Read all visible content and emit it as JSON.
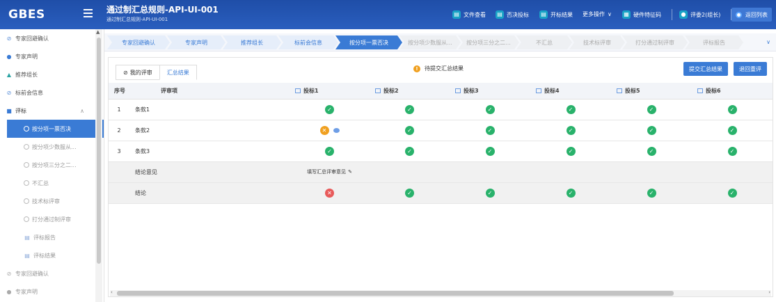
{
  "header": {
    "logo": "GBES",
    "project_title": "通过制汇总规则-API-UI-001",
    "project_subtitle": "通过制汇总规则-API-UI-001",
    "toolbar": [
      {
        "label": "文件查看",
        "icon": "file-icon",
        "color": "#19a3c6"
      },
      {
        "label": "否决投标",
        "icon": "reject-icon",
        "color": "#19a3c6"
      },
      {
        "label": "开标结果",
        "icon": "result-icon",
        "color": "#19a3c6"
      }
    ],
    "more_label": "更多操作",
    "hardware_label": "硬件特征码",
    "user_label": "评委2(组长)",
    "back_label": "返回列表"
  },
  "sidebar": {
    "items": [
      {
        "label": "专家回避确认",
        "icon": "check-circle-icon"
      },
      {
        "label": "专家声明",
        "icon": "user-icon"
      },
      {
        "label": "推荐组长",
        "icon": "users-icon"
      },
      {
        "label": "标前会信息",
        "icon": "check-circle-icon"
      },
      {
        "label": "评标",
        "icon": "folder-icon"
      }
    ],
    "sub_items": [
      {
        "label": "按分项一票否决",
        "active": true
      },
      {
        "label": "按分项少数服从..."
      },
      {
        "label": "按分项三分之二..."
      },
      {
        "label": "不汇总"
      },
      {
        "label": "技术标评审"
      },
      {
        "label": "打分通过制评审"
      }
    ],
    "bottom_items": [
      {
        "label": "评标报告",
        "icon": "doc-icon"
      },
      {
        "label": "评标结果",
        "icon": "doc-icon"
      },
      {
        "label": "专家回避确认",
        "icon": "check-circle-icon"
      },
      {
        "label": "专家声明",
        "icon": "user-icon"
      }
    ]
  },
  "steps": [
    "专家回避确认",
    "专家声明",
    "推荐组长",
    "标前会信息",
    "按分项一票否决",
    "按分项少数服从...",
    "按分项三分之二...",
    "不汇总",
    "技术标评审",
    "打分通过制评审",
    "评标报告"
  ],
  "active_step": 4,
  "tabs": {
    "my_review": "我的评审",
    "summary": "汇总结果"
  },
  "status_text": "待提交汇总结果",
  "buttons": {
    "submit": "提交汇总结果",
    "return": "退回重评"
  },
  "table": {
    "headers": [
      "序号",
      "评审项",
      "投标1",
      "投标2",
      "投标3",
      "投标4",
      "投标5",
      "投标6"
    ],
    "rows": [
      {
        "no": "1",
        "item": "条款1",
        "cells": [
          "ok",
          "ok",
          "ok",
          "ok",
          "ok",
          "ok"
        ]
      },
      {
        "no": "2",
        "item": "条款2",
        "cells": [
          "pending",
          "ok",
          "ok",
          "ok",
          "ok",
          "ok"
        ]
      },
      {
        "no": "3",
        "item": "条款3",
        "cells": [
          "ok",
          "ok",
          "ok",
          "ok",
          "ok",
          "ok"
        ]
      }
    ],
    "opinion_label": "结论意见",
    "opinion_link": "填写汇总评审意见",
    "conclusion_label": "结论",
    "conclusion": [
      "rejected",
      "ok",
      "ok",
      "ok",
      "ok",
      "ok"
    ]
  }
}
